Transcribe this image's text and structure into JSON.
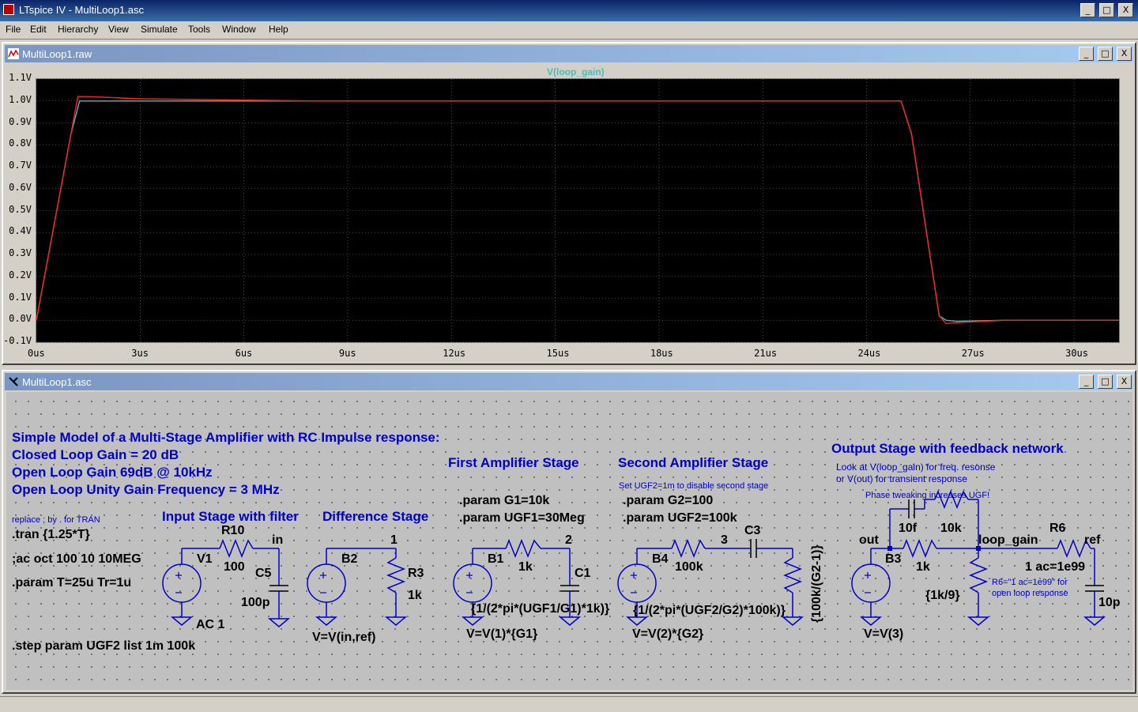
{
  "app": {
    "title": "LTspice IV - MultiLoop1.asc"
  },
  "menu": [
    "File",
    "Edit",
    "Hierarchy",
    "View",
    "Simulate",
    "Tools",
    "Window",
    "Help"
  ],
  "waveform_window": {
    "title": "MultiLoop1.raw",
    "trace_label": "V(loop_gain)"
  },
  "schematic_window": {
    "title": "MultiLoop1.asc"
  },
  "window_buttons": {
    "minimize": "_",
    "maximize": "□",
    "close": "X"
  },
  "colors": {
    "plot_bg": "#000000",
    "trace_red": "#ff2020",
    "trace_cyan": "#40c0c0",
    "schematic_bg": "#c0c0c0",
    "wire": "#0000c8",
    "text_blue": "#0000c8"
  },
  "chart_data": {
    "type": "line",
    "title": "V(loop_gain)",
    "yticks": [
      "1.1V",
      "1.0V",
      "0.9V",
      "0.8V",
      "0.7V",
      "0.6V",
      "0.5V",
      "0.4V",
      "0.3V",
      "0.2V",
      "0.1V",
      "0.0V",
      "-0.1V"
    ],
    "xticks": [
      "0us",
      "3us",
      "6us",
      "9us",
      "12us",
      "15us",
      "18us",
      "21us",
      "24us",
      "27us",
      "30us"
    ],
    "ylim": [
      -0.1,
      1.1
    ],
    "xlim": [
      0,
      31.3
    ],
    "series": [
      {
        "color": "#40c0c0",
        "x": [
          0,
          1.0,
          1.25,
          1.6,
          3.0,
          25.0,
          25.3,
          26.1,
          26.3,
          26.6,
          28.0,
          31.3
        ],
        "y": [
          0,
          0.85,
          1.0,
          1.0,
          1.0,
          1.0,
          0.85,
          0.02,
          0.0,
          -0.005,
          0.0,
          0.0
        ]
      },
      {
        "color": "#ff2020",
        "x": [
          0,
          1.0,
          1.2,
          1.5,
          3.0,
          8.0,
          25.0,
          25.3,
          26.1,
          26.3,
          26.7,
          28.0,
          31.3
        ],
        "y": [
          0,
          0.85,
          1.02,
          1.02,
          1.01,
          1.0,
          1.0,
          0.85,
          0.02,
          -0.015,
          -0.01,
          0.0,
          0.0
        ]
      }
    ]
  },
  "schematic": {
    "notes": {
      "title": "Simple Model of a Multi-Stage Amplifier with RC Impulse response:",
      "closed_loop": "Closed Loop Gain = 20 dB",
      "open_loop": "Open Loop Gain 69dB @ 10kHz",
      "ugf": "Open Loop Unity Gain Frequency = 3 MHz",
      "replace": "replace ; by . for TRAN",
      "tran": ".tran {1.25*T}",
      "ac": ";ac oct 100 10 10MEG",
      "param_t": ".param T=25u Tr=1u",
      "step": ".step param UGF2 list 1m 100k",
      "input_stage": "Input Stage with filter",
      "diff_stage": "Difference Stage",
      "first_stage": "First Amplifier Stage",
      "second_stage": "Second Amplifier Stage",
      "output_stage": "Output Stage with feedback network",
      "set_ugf2": "Set UGF2=1m to disable second stage",
      "look_at": "Look at V(loop_gain) for freq. resonse",
      "or_vout": "or V(out) for transient response",
      "phase": "Phase tweaking increases UGF!",
      "param_g1": ".param G1=10k",
      "param_ugf1": ".param UGF1=30Meg",
      "param_g2": ".param G2=100",
      "param_ugf2": ".param UGF2=100k",
      "r6_note1": "R6=\"1 ac=1e99\" for",
      "r6_note2": "open loop response"
    },
    "labels": {
      "r10": "R10",
      "r10_val": "100",
      "in": "in",
      "c5": "C5",
      "c5_val": "100p",
      "v1": "V1",
      "ac1": "AC 1",
      "b2": "B2",
      "b2_expr": "V=V(in,ref)",
      "node1": "1",
      "r3": "R3",
      "r3_val": "1k",
      "b1": "B1",
      "b1_expr": "V=V(1)*{G1}",
      "r_b1_val": "1k",
      "node2": "2",
      "c1": "C1",
      "c1_val": "{1/(2*pi*(UGF1/G1)*1k)}",
      "b4": "B4",
      "b4_expr": "V=V(2)*{G2}",
      "r_b4_val": "100k",
      "node3": "3",
      "c3": "C3",
      "c3_val": "{1/(2*pi*(UGF2/G2)*100k)}",
      "r_g2": "{100k/(G2-1)}",
      "out": "out",
      "b3": "B3",
      "b3_expr": "V=V(3)",
      "c_10f": "10f",
      "r_10k": "10k",
      "r_1k": "1k",
      "r_1k9": "{1k/9}",
      "loop_gain": "loop_gain",
      "r6": "R6",
      "r6_val": "1 ac=1e99",
      "ref": "ref",
      "c_10p": "10p"
    }
  }
}
